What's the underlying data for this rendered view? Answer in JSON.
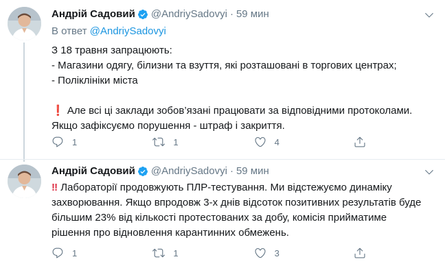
{
  "tweets": [
    {
      "author": "Андрій Садовий",
      "handle": "@AndriySadovyi",
      "separator": "·",
      "time": "59 мин",
      "reply_prefix": "В ответ",
      "reply_handle": "@AndriySadovyi",
      "lines": [
        "З 18 травня запрацюють:",
        "- Магазини одягу, білизни та взуття, які розташовані в торгових центрах;",
        "- Поліклініки міста"
      ],
      "lines2": [
        "Але всі ці заклади зобов’язані працювати за відповідними протоколами. Якщо зафіксуємо порушення - штраф і закриття."
      ],
      "emoji": "❗",
      "replies": "1",
      "retweets": "1",
      "likes": "4"
    },
    {
      "author": "Андрій Садовий",
      "handle": "@AndriySadovyi",
      "separator": "·",
      "time": "59 мин",
      "emoji": "‼",
      "body": "Лабораторії продовжують ПЛР-тестування. Ми відстежуємо динаміку захворювання. Якщо впродовж 3-х днів відсоток позитивних результатів буде більшим 23% від кількості протестованих за добу, комісія прийматиме рішення про відновлення карантинних обмежень.",
      "replies": "1",
      "retweets": "1",
      "likes": "3"
    }
  ],
  "icons": {
    "verified": "verified-badge-icon",
    "more": "chevron-down-icon",
    "reply": "reply-icon",
    "retweet": "retweet-icon",
    "like": "heart-icon",
    "share": "share-icon"
  },
  "colors": {
    "link": "#1b95e0",
    "muted": "#657786",
    "verified": "#1da1f2",
    "emoji": "#dd2e44"
  }
}
